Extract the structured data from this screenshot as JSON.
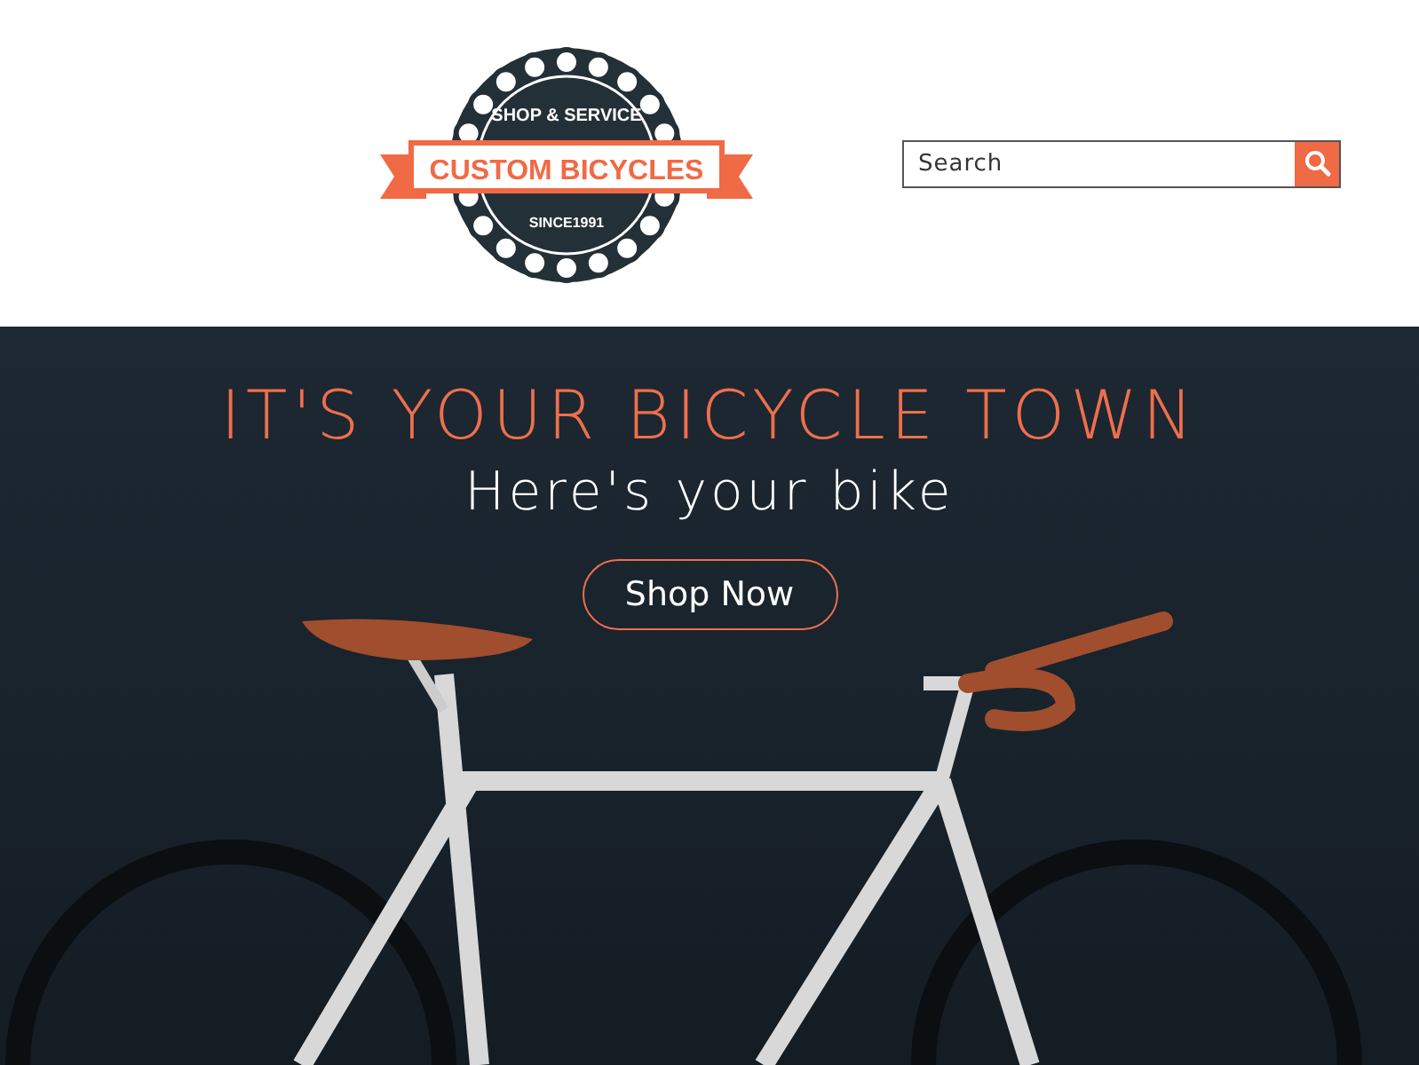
{
  "logo": {
    "top_text": "SHOP & SERVICE",
    "name": "CUSTOM BICYCLES",
    "since": "SINCE1991"
  },
  "search": {
    "placeholder": "Search"
  },
  "hero": {
    "title": "IT'S YOUR BICYCLE TOWN",
    "subtitle": "Here's your bike",
    "button": "Shop Now"
  }
}
